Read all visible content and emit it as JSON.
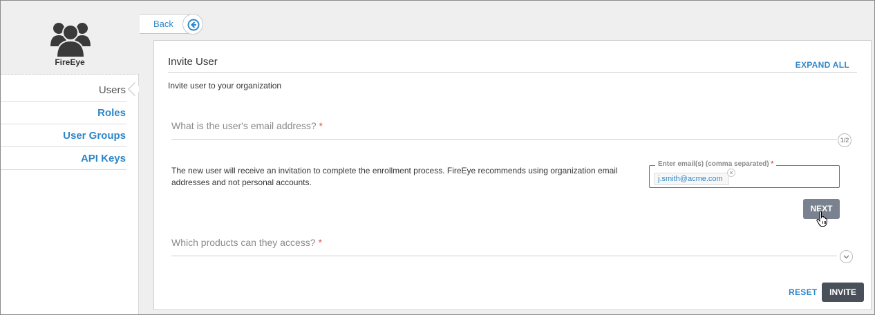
{
  "sidebar": {
    "brand": "FireEye",
    "items": [
      {
        "label": "Users",
        "active": true
      },
      {
        "label": "Roles",
        "active": false
      },
      {
        "label": "User Groups",
        "active": false
      },
      {
        "label": "API Keys",
        "active": false
      }
    ]
  },
  "topbar": {
    "back_label": "Back"
  },
  "panel": {
    "title": "Invite User",
    "expand_label": "EXPAND ALL",
    "subtitle": "Invite user to your organization",
    "step1": {
      "question": "What is the user's email address?",
      "required_mark": "*",
      "badge": "1/2",
      "description": "The new user will receive an invitation to complete the enrollment process. FireEye recommends using organization email addresses and not personal accounts.",
      "field_label": "Enter email(s) (comma separated)",
      "field_required": "*",
      "chip_value": "j.smith@acme.com",
      "chip_remove": "×",
      "next_label": "NEXT"
    },
    "step2": {
      "question": "Which products can they access?",
      "required_mark": "*"
    },
    "reset_label": "RESET",
    "invite_label": "INVITE"
  },
  "colors": {
    "accent": "#2e87c8",
    "required": "#d9534f",
    "next_button": "#7a8290",
    "invite_button": "#4a5059"
  },
  "icons": [
    "users-logo-icon",
    "back-arrow-icon",
    "chevron-down-icon",
    "hand-cursor-icon"
  ]
}
